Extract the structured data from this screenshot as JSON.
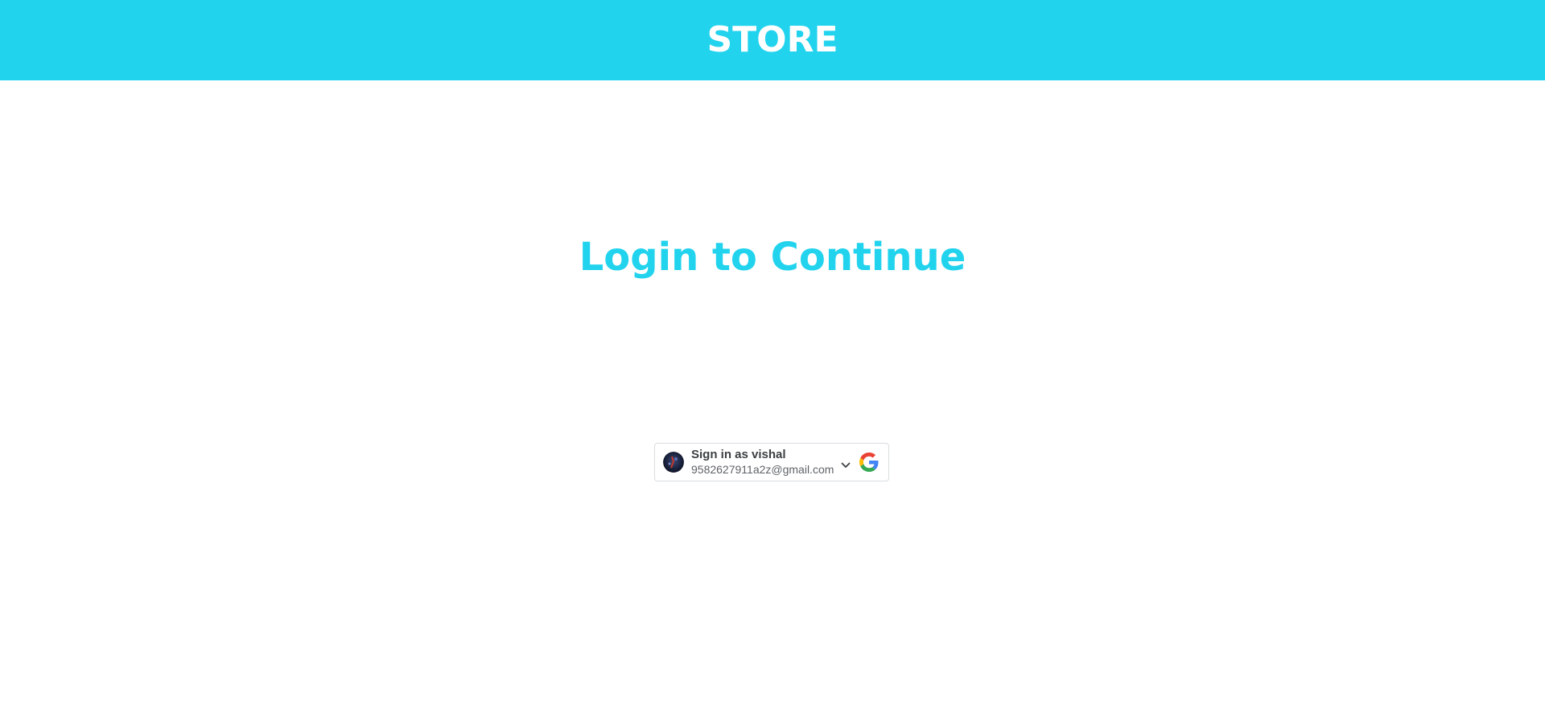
{
  "header": {
    "brand": "STORE",
    "background_color": "#22d3ee"
  },
  "main": {
    "title": "Login to Continue",
    "title_color": "#22d3ee"
  },
  "google_signin": {
    "label": "Sign in as vishal",
    "email": "9582627911a2z@gmail.com",
    "icons": [
      "avatar",
      "chevron-down-icon",
      "google-logo-icon"
    ]
  }
}
